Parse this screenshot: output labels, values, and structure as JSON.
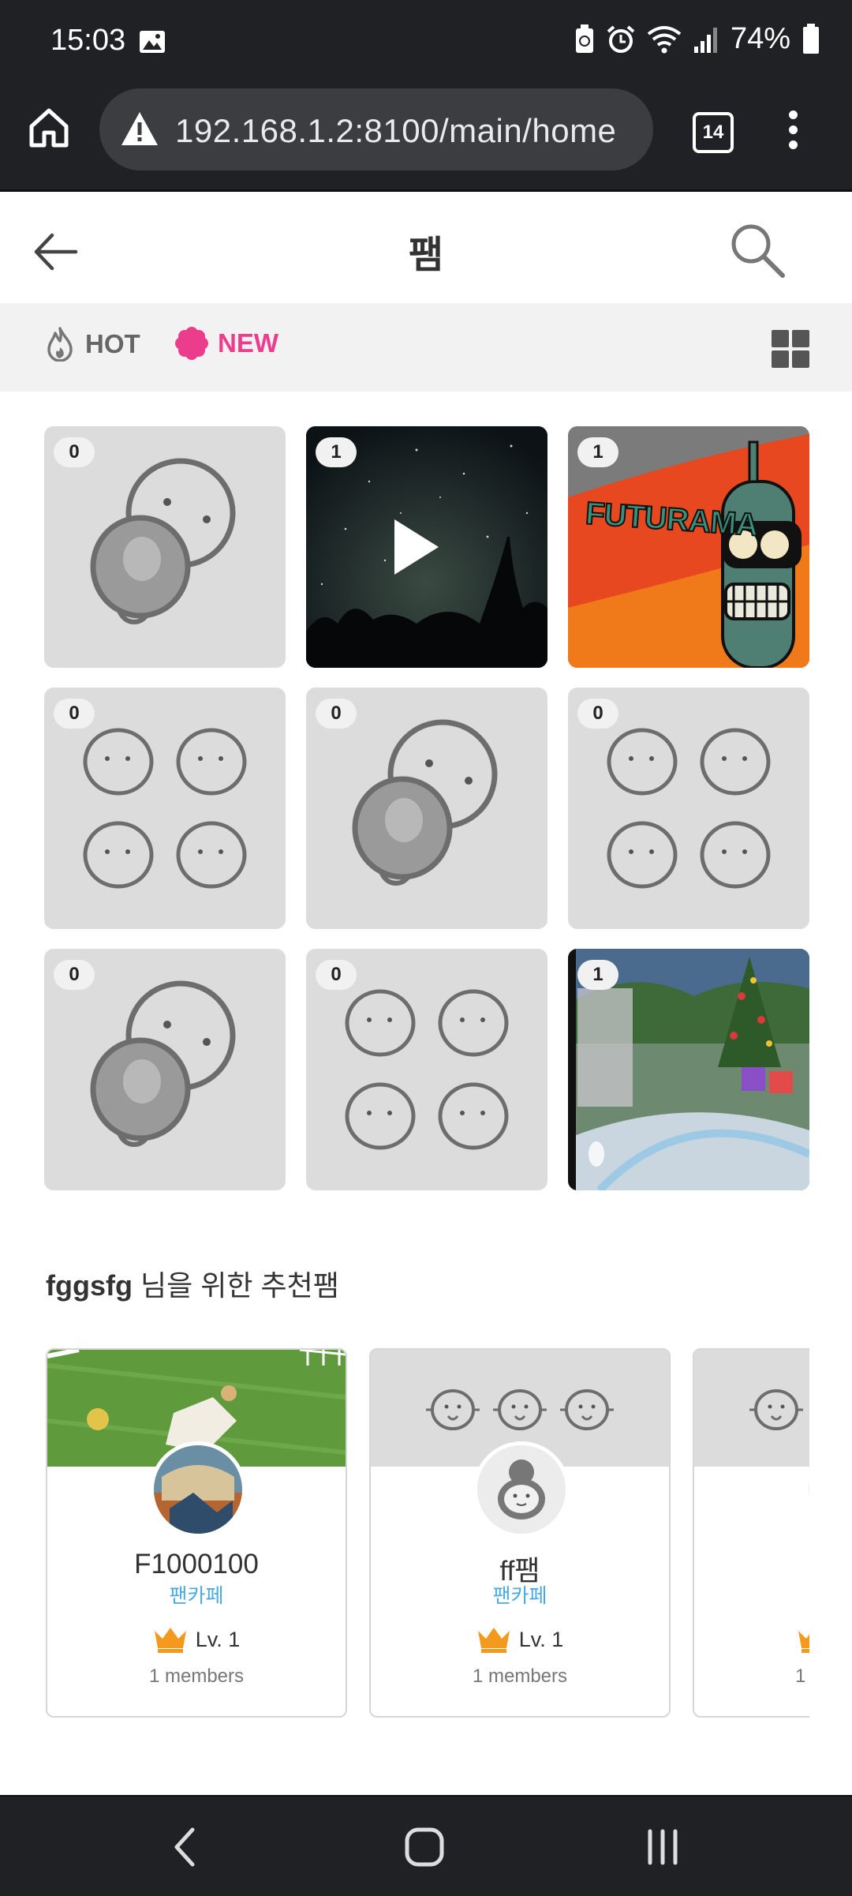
{
  "status_bar": {
    "time": "15:03",
    "battery": "74%"
  },
  "browser": {
    "url": "192.168.1.2:8100/main/home",
    "tab_count": "14"
  },
  "header": {
    "title": "팸"
  },
  "filters": {
    "hot": "HOT",
    "new": "NEW",
    "active": "NEW"
  },
  "tiles": [
    {
      "count": "0",
      "thumb": "single-mascot-icon"
    },
    {
      "count": "1",
      "thumb": "night-sky-video"
    },
    {
      "count": "1",
      "thumb": "futurama-image"
    },
    {
      "count": "0",
      "thumb": "four-faces-icon"
    },
    {
      "count": "0",
      "thumb": "single-mascot-icon"
    },
    {
      "count": "0",
      "thumb": "four-faces-icon"
    },
    {
      "count": "0",
      "thumb": "single-mascot-icon"
    },
    {
      "count": "0",
      "thumb": "four-faces-icon"
    },
    {
      "count": "1",
      "thumb": "game-screenshot"
    }
  ],
  "futurama_text": "FUTURAMA",
  "recommended": {
    "user": "fggsfg",
    "suffix": " 님을 위한 추천팸",
    "cards": [
      {
        "name": "F1000100",
        "type": "팬카페",
        "level": "Lv. 1",
        "members": "1 members"
      },
      {
        "name": "ff팸",
        "type": "팬카페",
        "level": "Lv. 1",
        "members": "1 members"
      },
      {
        "name": "",
        "type": "",
        "level": "",
        "members": "1"
      }
    ]
  },
  "colors": {
    "accent": "#ec3d8c",
    "link": "#4aa9df",
    "crown": "#f39a1e",
    "dark": "#202124"
  }
}
